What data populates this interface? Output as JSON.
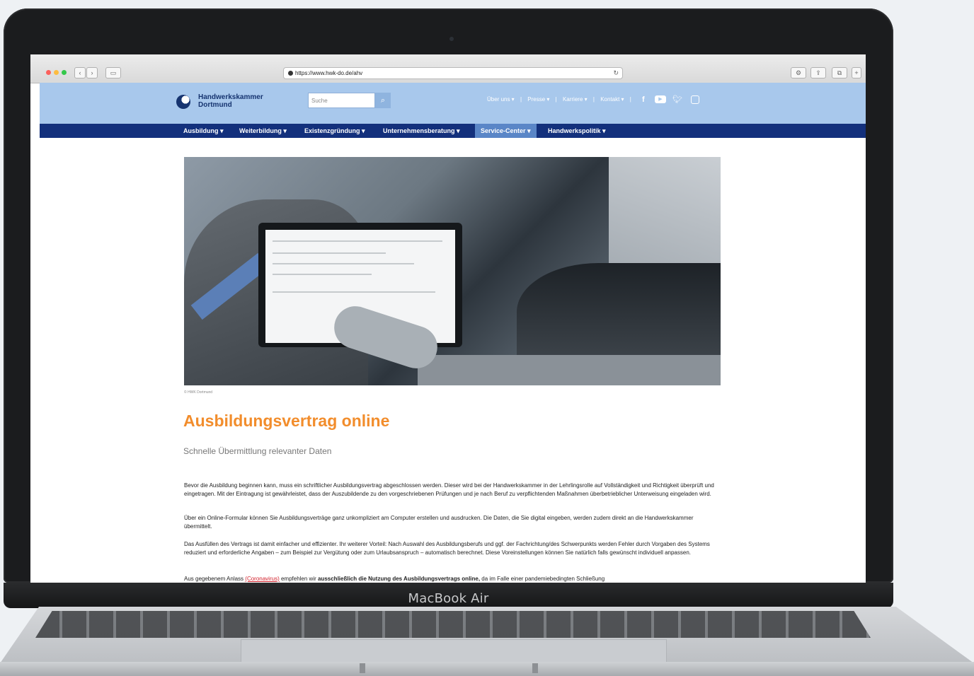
{
  "device": {
    "brand_label": "MacBook Air"
  },
  "browser": {
    "url": "https://www.hwk-do.de/ahv"
  },
  "site": {
    "logo_line1": "Handwerkskammer",
    "logo_line2": "Dortmund",
    "search_placeholder": "Suche",
    "top_links": [
      "Über uns ▾",
      "|",
      "Presse ▾",
      "|",
      "Karriere ▾",
      "|",
      "Kontakt ▾",
      "|"
    ],
    "social_icons": [
      "facebook-icon",
      "youtube-icon",
      "twitter-icon",
      "instagram-icon"
    ],
    "nav": [
      {
        "label": "Ausbildung ▾"
      },
      {
        "label": "Weiterbildung ▾"
      },
      {
        "label": "Existenzgründung ▾"
      },
      {
        "label": "Unternehmensberatung ▾"
      },
      {
        "label": "Service-Center ▾",
        "active": true
      },
      {
        "label": "Handwerkspolitik ▾"
      }
    ]
  },
  "content": {
    "image_caption": "© HWK Dortmund",
    "title": "Ausbildungsvertrag online",
    "subtitle": "Schnelle Übermittlung relevanter Daten",
    "paragraphs": [
      "Bevor die Ausbildung beginnen kann, muss ein schriftlicher Ausbildungsvertrag abgeschlossen werden. Dieser wird bei der Handwerkskammer in der Lehrlingsrolle auf Vollständigkeit und Richtigkeit überprüft und eingetragen. Mit der Eintragung ist gewährleistet, dass der Auszubildende zu den vorgeschriebenen Prüfungen und je nach Beruf zu verpflichtenden Maßnahmen überbetrieblicher Unterweisung eingeladen wird.",
      "Über ein Online-Formular können Sie Ausbildungsverträge ganz unkompliziert am Computer erstellen und ausdrucken. Die Daten, die Sie digital eingeben, werden zudem direkt an die Handwerkskammer übermittelt.",
      "Das Ausfüllen des Vertrags ist damit einfacher und effizienter. Ihr weiterer Vorteil: Nach Auswahl des Ausbildungsberufs und ggf. der Fachrichtung/des Schwerpunkts werden Fehler durch Vorgaben des Systems reduziert und erforderliche Angaben – zum Beispiel zur Vergütung oder zum Urlaubsanspruch – automatisch berechnet. Diese Voreinstellungen können Sie natürlich falls gewünscht individuell anpassen."
    ],
    "last_para": {
      "before": "Aus gegebenem Anlass ",
      "link": "(Coronavirus)",
      "middle": " empfehlen wir ",
      "bold": "ausschließlich die Nutzung des Ausbildungsvertrags online,",
      "after": " da im Falle einer pandemiebedingten Schließung"
    }
  }
}
